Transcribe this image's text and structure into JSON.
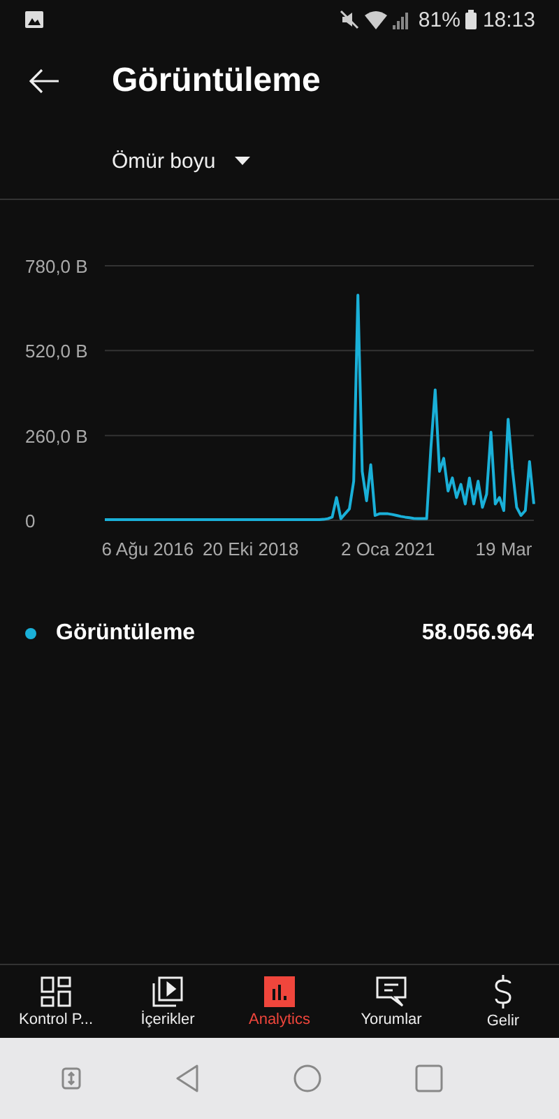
{
  "status_bar": {
    "battery": "81%",
    "time": "18:13"
  },
  "header": {
    "title": "Görüntüleme"
  },
  "period_dropdown": {
    "value": "Ömür boyu"
  },
  "chart": {
    "chart_data": {
      "type": "line",
      "ylim": [
        0,
        780
      ],
      "yticks": [
        {
          "value": 0,
          "label": "0"
        },
        {
          "value": 260,
          "label": "260,0 B"
        },
        {
          "value": 520,
          "label": "520,0 B"
        },
        {
          "value": 780,
          "label": "780,0 B"
        }
      ],
      "categories": [
        null,
        null,
        null,
        null,
        null,
        null,
        null,
        null,
        null,
        null,
        "6 Ağu 2016",
        null,
        null,
        null,
        null,
        null,
        null,
        null,
        null,
        null,
        null,
        null,
        null,
        null,
        null,
        null,
        null,
        null,
        null,
        null,
        null,
        null,
        null,
        null,
        "20 Eki 2018",
        null,
        null,
        null,
        null,
        null,
        null,
        null,
        null,
        null,
        null,
        null,
        null,
        null,
        null,
        null,
        null,
        null,
        null,
        null,
        null,
        null,
        null,
        null,
        null,
        null,
        null,
        null,
        null,
        null,
        null,
        null,
        "2 Oca 2021",
        null,
        null,
        null,
        null,
        null,
        null,
        null,
        null,
        null,
        null,
        null,
        null,
        null,
        null,
        null,
        null,
        null,
        null,
        null,
        null,
        null,
        null,
        null,
        null,
        null,
        null,
        "19 Mar",
        null,
        null,
        null,
        null,
        null,
        null,
        null
      ],
      "series": [
        {
          "name": "Görüntüleme",
          "color": "#1ab0d8",
          "values": [
            2,
            2,
            2,
            2,
            2,
            2,
            2,
            2,
            2,
            2,
            2,
            2,
            2,
            2,
            2,
            2,
            2,
            2,
            2,
            2,
            2,
            2,
            2,
            2,
            2,
            2,
            2,
            2,
            2,
            2,
            2,
            2,
            2,
            2,
            2,
            2,
            2,
            2,
            2,
            2,
            2,
            2,
            2,
            2,
            2,
            2,
            2,
            2,
            2,
            2,
            2,
            3,
            5,
            10,
            70,
            5,
            20,
            35,
            120,
            690,
            150,
            60,
            170,
            15,
            20,
            20,
            20,
            18,
            15,
            12,
            10,
            8,
            6,
            5,
            5,
            5,
            220,
            400,
            150,
            190,
            90,
            130,
            70,
            110,
            50,
            130,
            50,
            120,
            40,
            80,
            270,
            50,
            70,
            30,
            310,
            160,
            40,
            15,
            30,
            180,
            50
          ]
        }
      ]
    }
  },
  "legend": {
    "total": "58.056.964"
  },
  "bottom_nav": [
    {
      "kind": "dashboard",
      "label": "Kontrol P...",
      "selected": false
    },
    {
      "kind": "content",
      "label": "İçerikler",
      "selected": false
    },
    {
      "kind": "analytics",
      "label": "Analytics",
      "selected": true
    },
    {
      "kind": "comments",
      "label": "Yorumlar",
      "selected": false
    },
    {
      "kind": "earn",
      "label": "Gelir",
      "selected": false
    }
  ]
}
